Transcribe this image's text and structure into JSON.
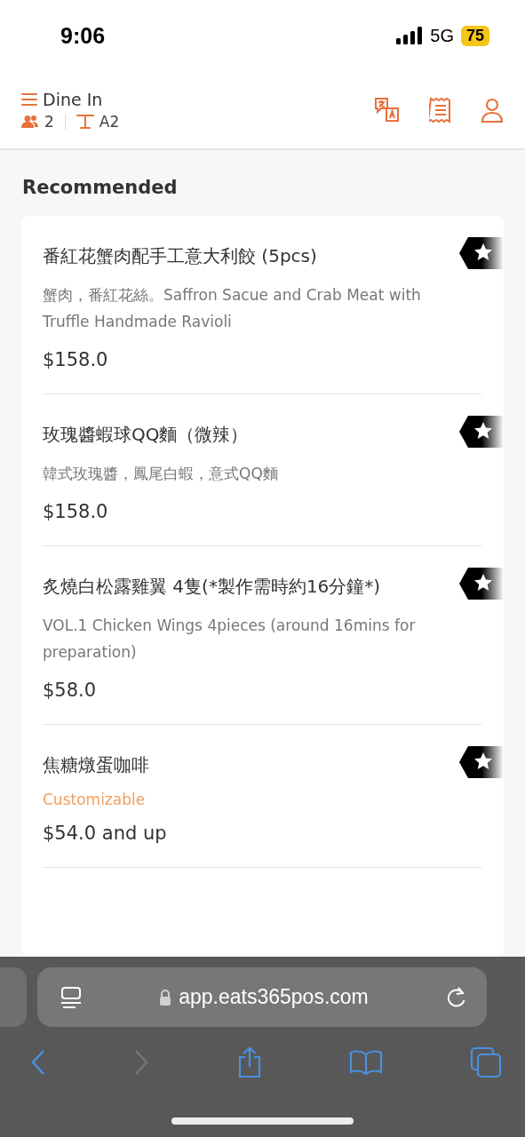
{
  "status_bar": {
    "time": "9:06",
    "network": "5G",
    "battery": "75"
  },
  "header": {
    "mode": "Dine In",
    "guests": "2",
    "table": "A2"
  },
  "section_title": "Recommended",
  "items": [
    {
      "name": "番紅花蟹肉配手工意大利餃 (5pcs)",
      "description": "蟹肉，番紅花絲。Saffron Sacue and Crab Meat with Truffle Handmade Ravioli",
      "price": "$158.0"
    },
    {
      "name": "玫瑰醬蝦球QQ麵（微辣）",
      "description": "韓式玫瑰醬，鳳尾白蝦，意式QQ麵",
      "price": "$158.0"
    },
    {
      "name": "炙燒白松露雞翼 4隻(*製作需時約16分鐘*)",
      "description": "VOL.1 Chicken Wings 4pieces (around 16mins for preparation)",
      "price": "$58.0"
    },
    {
      "name": "焦糖燉蛋咖啡",
      "note": "Customizable",
      "price": "$54.0 and up"
    }
  ],
  "browser": {
    "url": "app.eats365pos.com",
    "forward_disabled": true
  }
}
